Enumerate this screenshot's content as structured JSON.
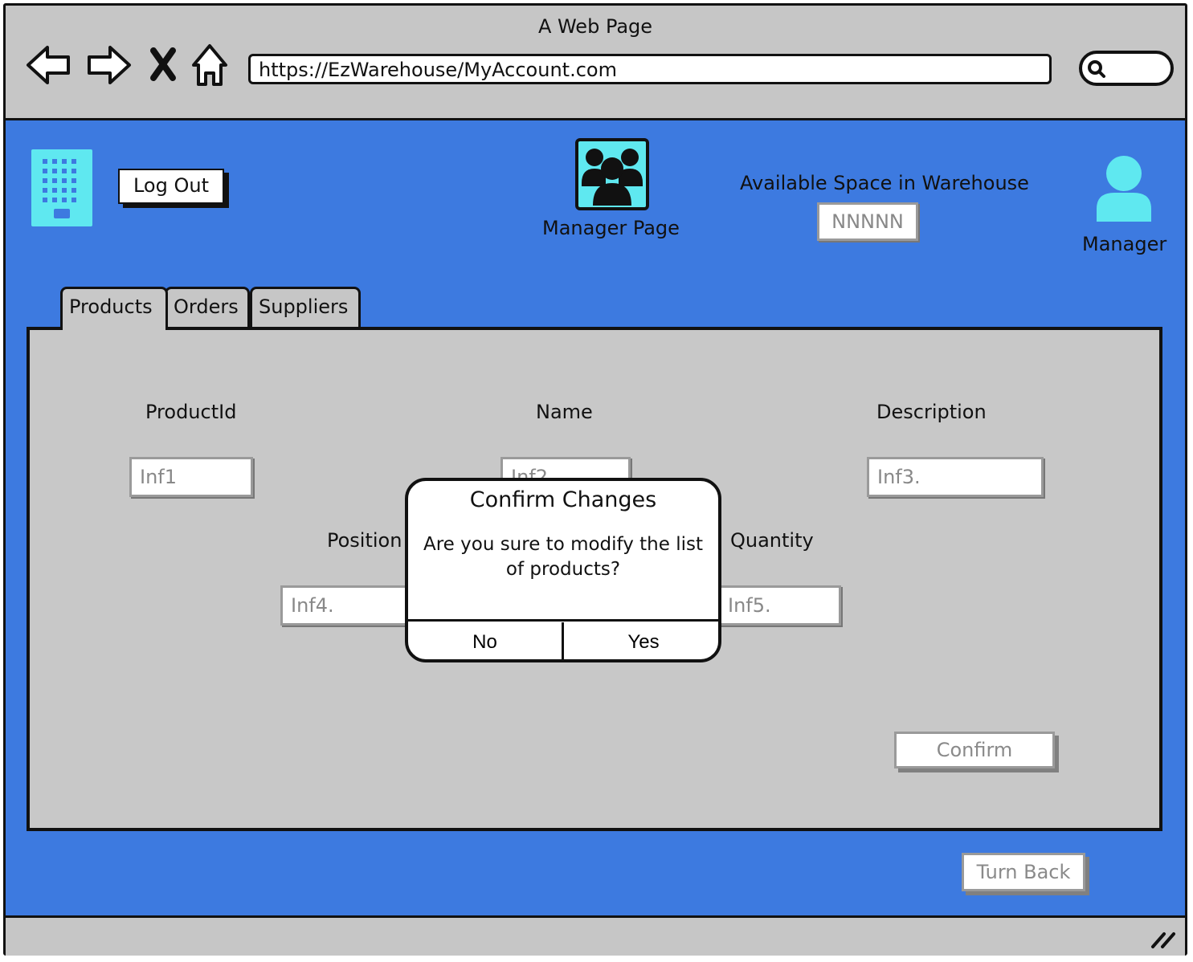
{
  "browser": {
    "window_title": "A Web Page",
    "url": "https://EzWarehouse/MyAccount.com"
  },
  "header": {
    "logout_label": "Log Out",
    "page_title": "Manager Page",
    "space_label": "Available Space in Warehouse",
    "space_value": "NNNNN",
    "user_label": "Manager"
  },
  "tabs": [
    {
      "label": "Products"
    },
    {
      "label": "Orders"
    },
    {
      "label": "Suppliers"
    }
  ],
  "form": {
    "product_id_label": "ProductId",
    "name_label": "Name",
    "description_label": "Description",
    "position_label": "Position",
    "quantity_label": "Quantity",
    "product_id_value": "Inf1",
    "name_value": "Inf2",
    "description_value": "Inf3.",
    "position_value": "Inf4.",
    "quantity_value": "Inf5.",
    "confirm_label": "Confirm"
  },
  "dialog": {
    "title": "Confirm Changes",
    "message": "Are you sure to modify the list of products?",
    "no_label": "No",
    "yes_label": "Yes"
  },
  "footer": {
    "turn_back_label": "Turn Back"
  },
  "colors": {
    "content_bg": "#3d7ae0",
    "chrome_bg": "#c6c6c6",
    "icon_accent": "#5fe8f0"
  }
}
